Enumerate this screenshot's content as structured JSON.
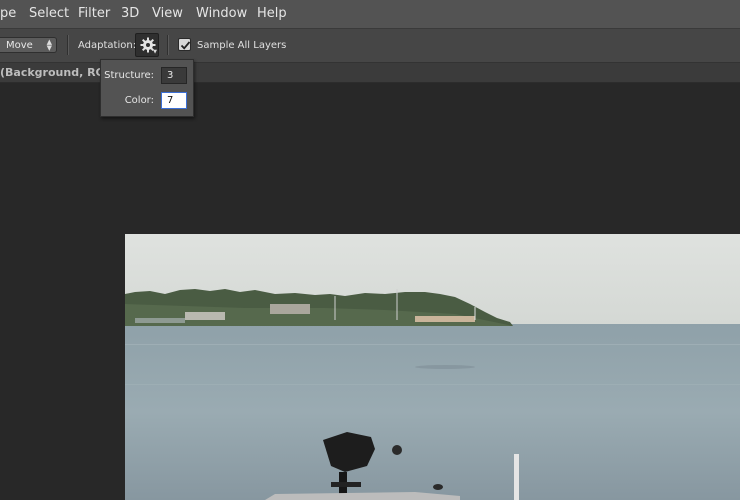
{
  "menubar": {
    "items": [
      {
        "label": "pe"
      },
      {
        "label": "Select"
      },
      {
        "label": "Filter"
      },
      {
        "label": "3D"
      },
      {
        "label": "View"
      },
      {
        "label": "Window"
      },
      {
        "label": "Help"
      }
    ]
  },
  "options": {
    "mode_value": "Move",
    "adaptation_label": "Adaptation:",
    "adaptation_icon": "gear-icon",
    "sample_all_layers_label": "Sample All Layers",
    "sample_all_layers_checked": true
  },
  "document": {
    "tab_title": "(Background, RGB/"
  },
  "adaptation_popup": {
    "structure_label": "Structure:",
    "structure_value": "3",
    "color_label": "Color:",
    "color_value": "7"
  },
  "colors": {
    "menubar_bg": "#535353",
    "options_bg": "#464646",
    "canvas_bg": "#282828",
    "focus_border": "#3b6fd6"
  }
}
